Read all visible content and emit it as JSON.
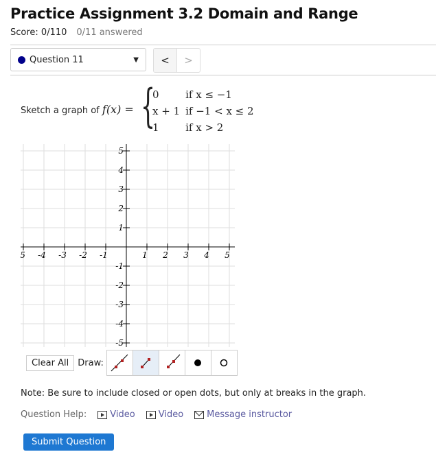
{
  "header": {
    "title": "Practice Assignment 3.2 Domain and Range",
    "score": "Score: 0/110",
    "answered": "0/11 answered"
  },
  "question_nav": {
    "selected": "Question 11",
    "status_color": "#00008b",
    "prev": "<",
    "next": ">"
  },
  "question": {
    "prompt": "Sketch a graph of",
    "func": "f(x) =",
    "cases": [
      {
        "expr": "0",
        "cond": "if  x ≤ −1"
      },
      {
        "expr": "x + 1",
        "cond": "if  −1 < x ≤ 2"
      },
      {
        "expr": "1",
        "cond": "if  x > 2"
      }
    ]
  },
  "graph": {
    "x_ticks": [
      "-5",
      "-4",
      "-3",
      "-2",
      "-1",
      "1",
      "2",
      "3",
      "4",
      "5"
    ],
    "y_ticks": [
      "5",
      "4",
      "3",
      "2",
      "1",
      "-1",
      "-2",
      "-3",
      "-4",
      "-5"
    ],
    "xlim": [
      -5,
      5
    ],
    "ylim": [
      -5,
      5
    ],
    "grid": true
  },
  "tools": {
    "clear_label": "Clear All",
    "draw_label": "Draw:",
    "buttons": [
      {
        "name": "line-tool",
        "selected": false
      },
      {
        "name": "segment-tool",
        "selected": true
      },
      {
        "name": "ray-tool",
        "selected": false
      },
      {
        "name": "closed-dot-tool",
        "selected": false
      },
      {
        "name": "open-dot-tool",
        "selected": false
      }
    ]
  },
  "note": "Note: Be sure to include closed or open dots, but only at breaks in the graph.",
  "help": {
    "label": "Question Help:",
    "links": [
      "Video",
      "Video",
      "Message instructor"
    ]
  },
  "submit_label": "Submit Question",
  "colors": {
    "accent": "#1e78d2",
    "link": "#5a5aa0",
    "tool_point": "#b22222"
  }
}
